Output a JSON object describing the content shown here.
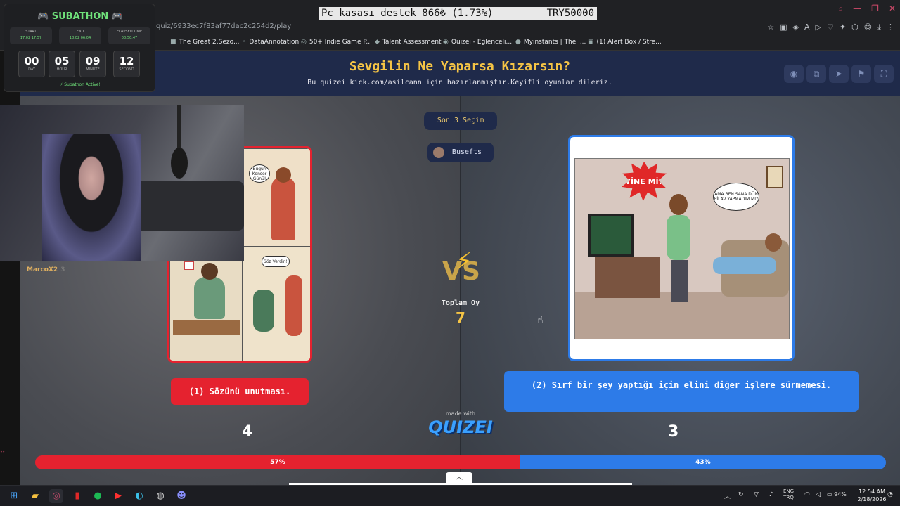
{
  "browser": {
    "title_banner_left": "Pc kasası destek  866₺ (1.73%)",
    "title_banner_right": "TRY50000",
    "url": "quiz/6933ec7f83af77dac2c254d2/play",
    "bookmarks": [
      "The Great 2.Sezo...",
      "DataAnnotation",
      "50+ Indie Game P...",
      "Talent Assessment",
      "Quizei - Eğlenceli...",
      "Myinstants | The I...",
      "(1) Alert Box / Stre..."
    ]
  },
  "quiz": {
    "title": "Sevgilin Ne Yaparsa Kızarsın?",
    "subtitle": "Bu quizei kick.com/asilcann için hazırlanmıştır.Keyifli oyunlar dileriz.",
    "last_choices_label": "Son 3 Seçim",
    "last_voter": "Busefts",
    "vs_label": "VS",
    "total_label": "Toplam Oy",
    "total_votes": "7",
    "made_with": "made with",
    "logo": "QUIZEI",
    "left_option": {
      "label": "(1) Sözünü unutması.",
      "votes": "4",
      "percent_text": "57%",
      "percent": 57,
      "speech_1": "Bugün Konser Günü!",
      "speech_2": "Söz Verdin!"
    },
    "right_option": {
      "label": "(2) Sırf bir şey yaptığı için elini diğer işlere sürmemesi.",
      "votes": "3",
      "percent_text": "43%",
      "percent": 43,
      "burst": "YİNE Mİ?",
      "speech": "AMA BEN SANA DÜN PİLAV YAPMADIM MI?"
    }
  },
  "overlay": {
    "title": "🎮 SUBATHON 🎮",
    "start_label": "START",
    "start_value": "17.02 17:57",
    "end_label": "END",
    "end_value": "18.02 06:04",
    "elapsed_label": "ELAPSED TIME",
    "elapsed_value": "00:50:47",
    "day": "00",
    "day_label": "DAY",
    "hour": "05",
    "hour_label": "HOUR",
    "minute": "09",
    "minute_label": "MINUTE",
    "second": "12",
    "second_label": "SECOND",
    "status": "⚡ Subathon Active!"
  },
  "chat": {
    "user": "MarcoX2",
    "count": "3"
  },
  "taskbar": {
    "lang_top": "ENG",
    "lang_bottom": "TRQ",
    "battery": "94%",
    "time": "12:54 AM",
    "date": "2/18/2026"
  },
  "colors": {
    "left": "#e5222f",
    "right": "#2d7be8",
    "title": "#f5c445"
  }
}
